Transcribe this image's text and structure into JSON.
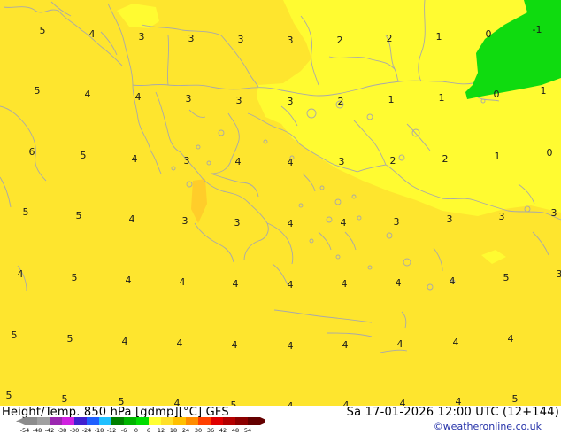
{
  "title": {
    "left": "Height/Temp. 850 hPa [gdmp][°C] GFS",
    "right": "Sa 17-01-2026 12:00 UTC (12+144)"
  },
  "credit": "©weatheronline.co.uk",
  "colorbar": {
    "ticks": [
      "-54",
      "-48",
      "-42",
      "-38",
      "-30",
      "-24",
      "-18",
      "-12",
      "-6",
      "0",
      "6",
      "12",
      "18",
      "24",
      "30",
      "36",
      "42",
      "48",
      "54"
    ],
    "colors": [
      "#8c8c8c",
      "#a0a0a0",
      "#9b27b0",
      "#d020e0",
      "#4020d0",
      "#2060ff",
      "#20c0ff",
      "#008000",
      "#00b400",
      "#00dd00",
      "#ffff33",
      "#ffe028",
      "#ffc000",
      "#ff8c00",
      "#ff4000",
      "#e00000",
      "#b40000",
      "#8c0000",
      "#640000"
    ]
  },
  "map_colors": {
    "yellow_warm": "#fee52e",
    "yellow_light": "#fffb31",
    "green": "#0fdb0f",
    "orange": "#ffcd2a",
    "border": "#a9a9a9"
  },
  "temperature_labels": [
    "5",
    "4",
    "3",
    "3",
    "3",
    "3",
    "2",
    "2",
    "1",
    "0",
    "-1",
    "5",
    "4",
    "4",
    "3",
    "3",
    "3",
    "2",
    "1",
    "1",
    "0",
    "1",
    "6",
    "5",
    "4",
    "3",
    "4",
    "4",
    "3",
    "2",
    "2",
    "1",
    "0",
    "5",
    "5",
    "4",
    "3",
    "3",
    "4",
    "4",
    "3",
    "3",
    "3",
    "3",
    "4",
    "5",
    "4",
    "4",
    "4",
    "4",
    "4",
    "4",
    "4",
    "5",
    "3",
    "5",
    "5",
    "4",
    "4",
    "4",
    "4",
    "4",
    "4",
    "4",
    "4",
    "5",
    "5",
    "5",
    "4",
    "5",
    "4",
    "4",
    "4",
    "4",
    "5"
  ]
}
